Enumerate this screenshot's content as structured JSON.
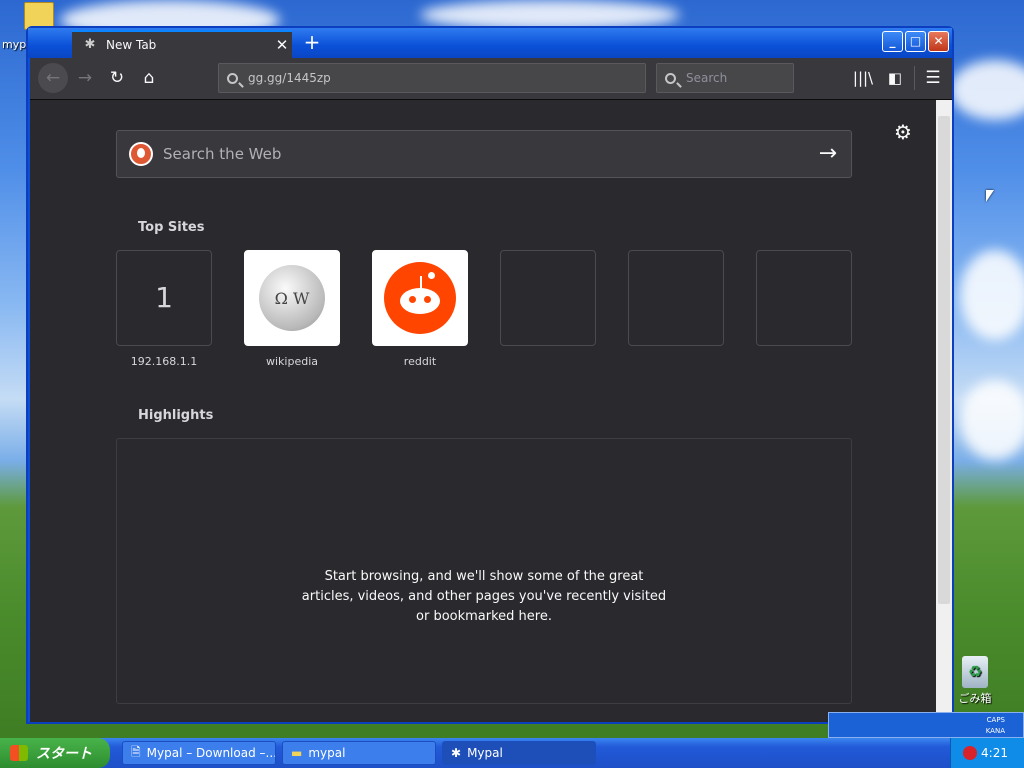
{
  "desktop": {
    "top_icon_label": "myp",
    "recycle_label": "ごみ箱"
  },
  "window": {
    "tab_title": "New Tab",
    "url": "gg.gg/1445zp",
    "search_placeholder": "Search"
  },
  "newtab": {
    "search_placeholder": "Search the Web",
    "top_sites_title": "Top Sites",
    "top_sites": [
      {
        "label": "192.168.1.1",
        "tile_text": "1"
      },
      {
        "label": "wikipedia",
        "tile_text": ""
      },
      {
        "label": "reddit",
        "tile_text": ""
      },
      {
        "label": "",
        "tile_text": ""
      },
      {
        "label": "",
        "tile_text": ""
      },
      {
        "label": "",
        "tile_text": ""
      }
    ],
    "highlights_title": "Highlights",
    "highlights_empty": "Start browsing, and we'll show some of the great articles, videos, and other pages you've recently visited or bookmarked here."
  },
  "taskbar": {
    "start_label": "スタート",
    "items": [
      {
        "label": "Mypal – Download –..."
      },
      {
        "label": "mypal"
      },
      {
        "label": "Mypal"
      }
    ],
    "clock": "4:21",
    "langbar": [
      "CAPS",
      "KANA"
    ]
  },
  "colors": {
    "accent": "#0a84ff",
    "reddit": "#ff4500",
    "content_bg": "#2a2a2e"
  }
}
